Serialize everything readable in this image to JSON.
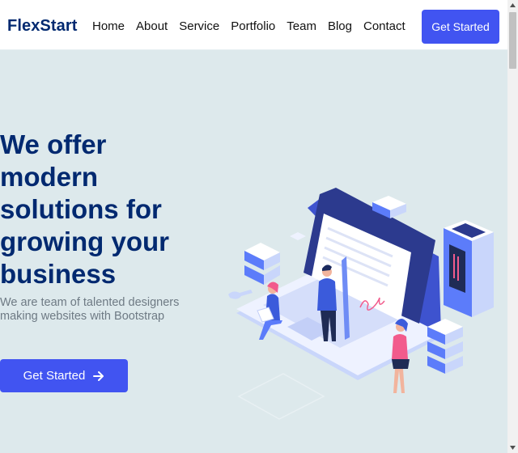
{
  "header": {
    "logo": "FlexStart",
    "nav": [
      "Home",
      "About",
      "Service",
      "Portfolio",
      "Team",
      "Blog",
      "Contact"
    ],
    "cta_label": "Get Started"
  },
  "hero": {
    "title": "We offer modern solutions for growing your business",
    "subtitle": "We are team of talented designers making websites with Bootstrap",
    "cta_label": "Get Started"
  },
  "colors": {
    "brand": "#012970",
    "accent": "#4154f1",
    "hero_bg": "#dde9ec"
  },
  "icons": {
    "cta_arrow": "arrow-right-icon"
  }
}
